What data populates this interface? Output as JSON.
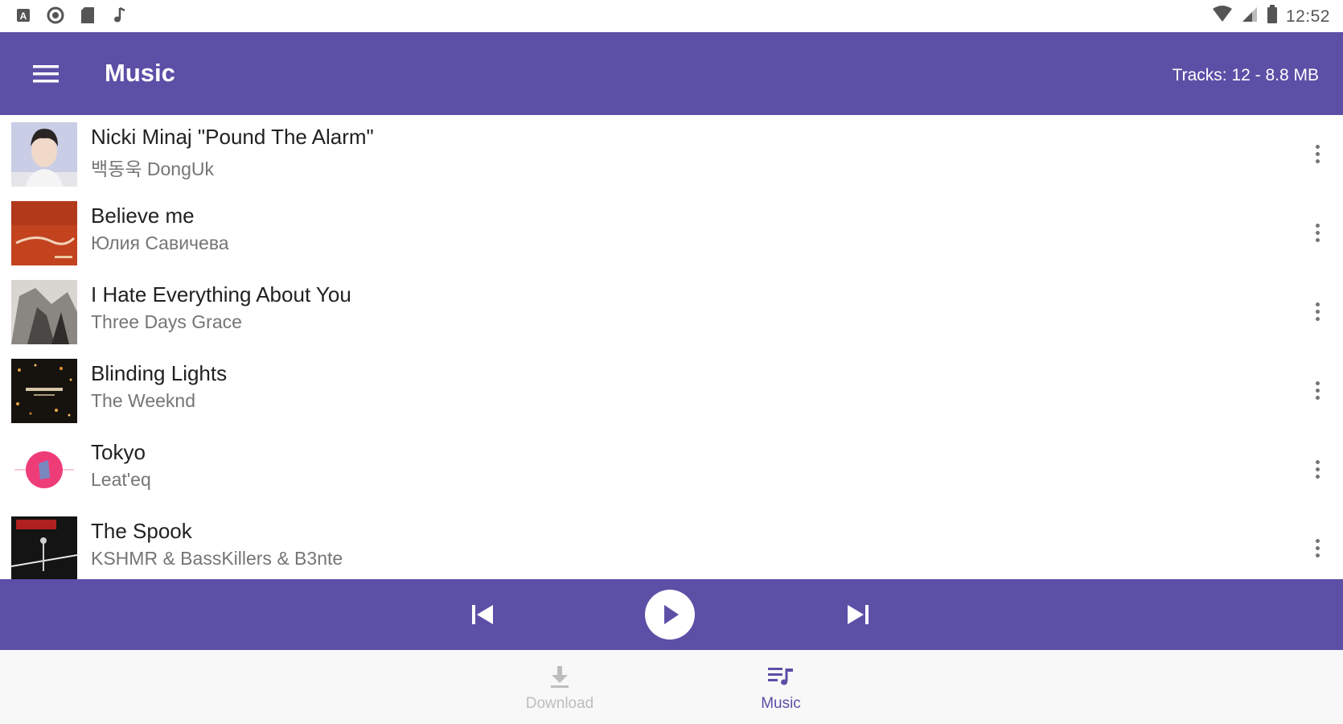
{
  "status_bar": {
    "time": "12:52"
  },
  "app_bar": {
    "title": "Music",
    "meta": "Tracks: 12  -  8.8 MB"
  },
  "tracks": [
    {
      "title": "Nicki Minaj \"Pound The Alarm\"",
      "artist": "백동욱 DongUk"
    },
    {
      "title": "Believe me",
      "artist": "Юлия Савичева"
    },
    {
      "title": "I Hate Everything About You",
      "artist": "Three Days Grace"
    },
    {
      "title": "Blinding Lights",
      "artist": "The Weeknd"
    },
    {
      "title": "Tokyo",
      "artist": "Leat'eq"
    },
    {
      "title": "The Spook",
      "artist": "KSHMR & BassKillers & B3nte"
    }
  ],
  "bottom_nav": {
    "download_label": "Download",
    "music_label": "Music",
    "active": "Music"
  },
  "colors": {
    "primary": "#5c4fa6",
    "nav_inactive": "#bdbdbd",
    "text_secondary": "#757575"
  },
  "icons": {
    "menu": "hamburger-menu-icon",
    "more": "more-vert-icon",
    "prev": "skip-previous-icon",
    "play": "play-icon",
    "next": "skip-next-icon",
    "download": "download-icon",
    "music": "queue-music-icon"
  }
}
